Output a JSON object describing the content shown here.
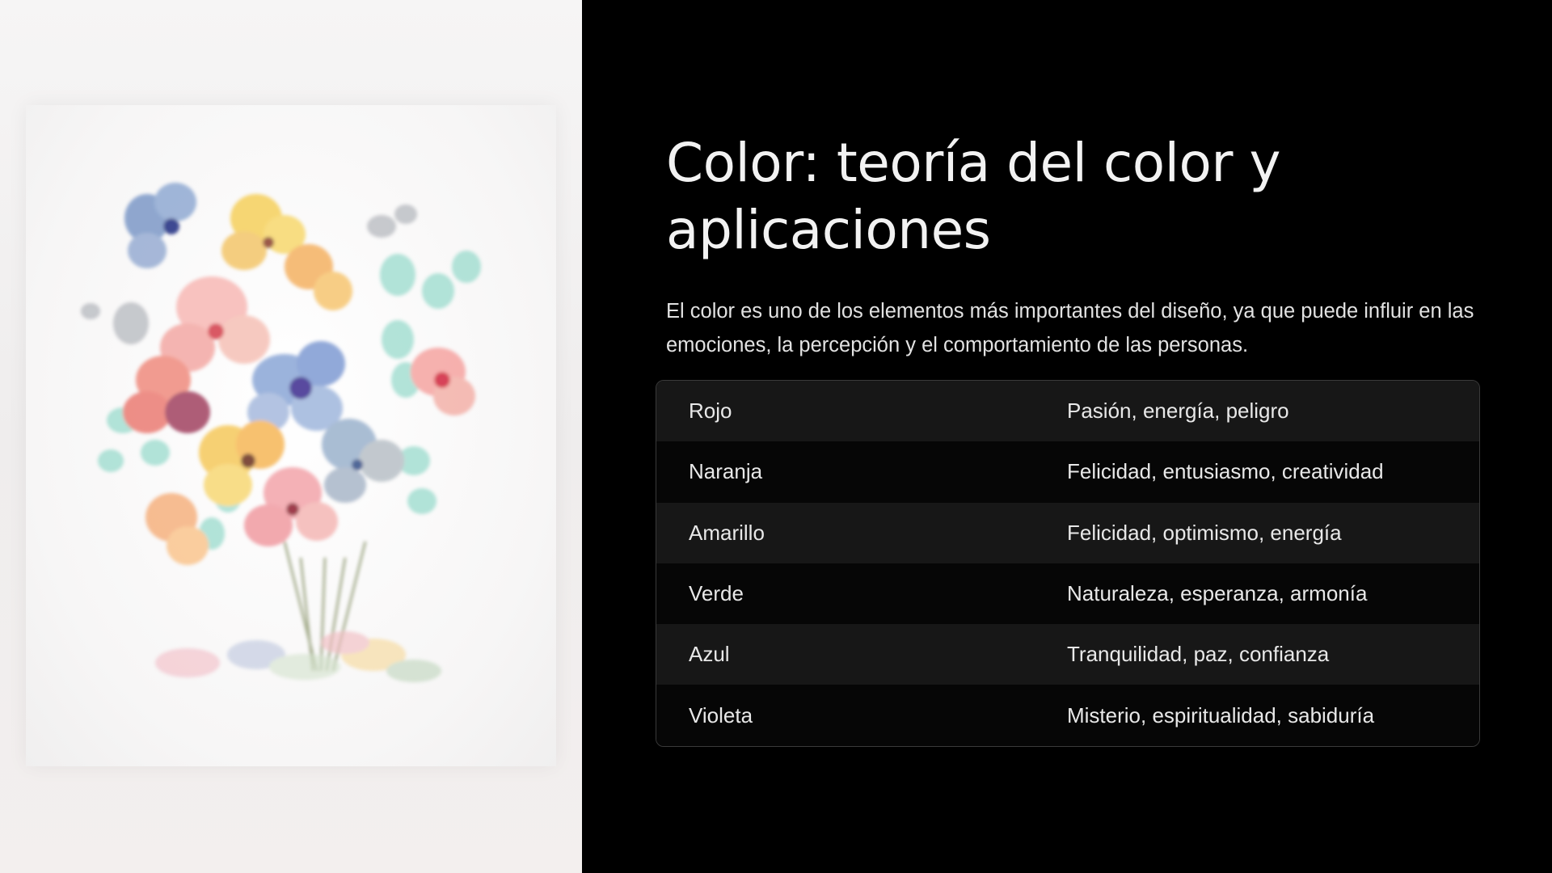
{
  "slide": {
    "title": "Color: teoría del color y aplicaciones",
    "description": "El color es uno de los elementos más importantes del diseño, ya que puede influir en las emociones, la percepción y el comportamiento de las personas.",
    "image": {
      "subject": "watercolor-flower-bouquet-illustration"
    },
    "table": {
      "rows": [
        {
          "color": "Rojo",
          "meaning": "Pasión, energía, peligro"
        },
        {
          "color": "Naranja",
          "meaning": "Felicidad, entusiasmo, creatividad"
        },
        {
          "color": "Amarillo",
          "meaning": "Felicidad, optimismo, energía"
        },
        {
          "color": "Verde",
          "meaning": "Naturaleza, esperanza, armonía"
        },
        {
          "color": "Azul",
          "meaning": "Tranquilidad, paz, confianza"
        },
        {
          "color": "Violeta",
          "meaning": "Misterio, espiritualidad, sabiduría"
        }
      ]
    }
  },
  "colors": {
    "background": "#000000",
    "title_text": "#f2f2f2",
    "body_text": "#e2e2e2",
    "row_odd": "#171717",
    "row_even": "#060606",
    "table_border": "#3a3a3a"
  }
}
